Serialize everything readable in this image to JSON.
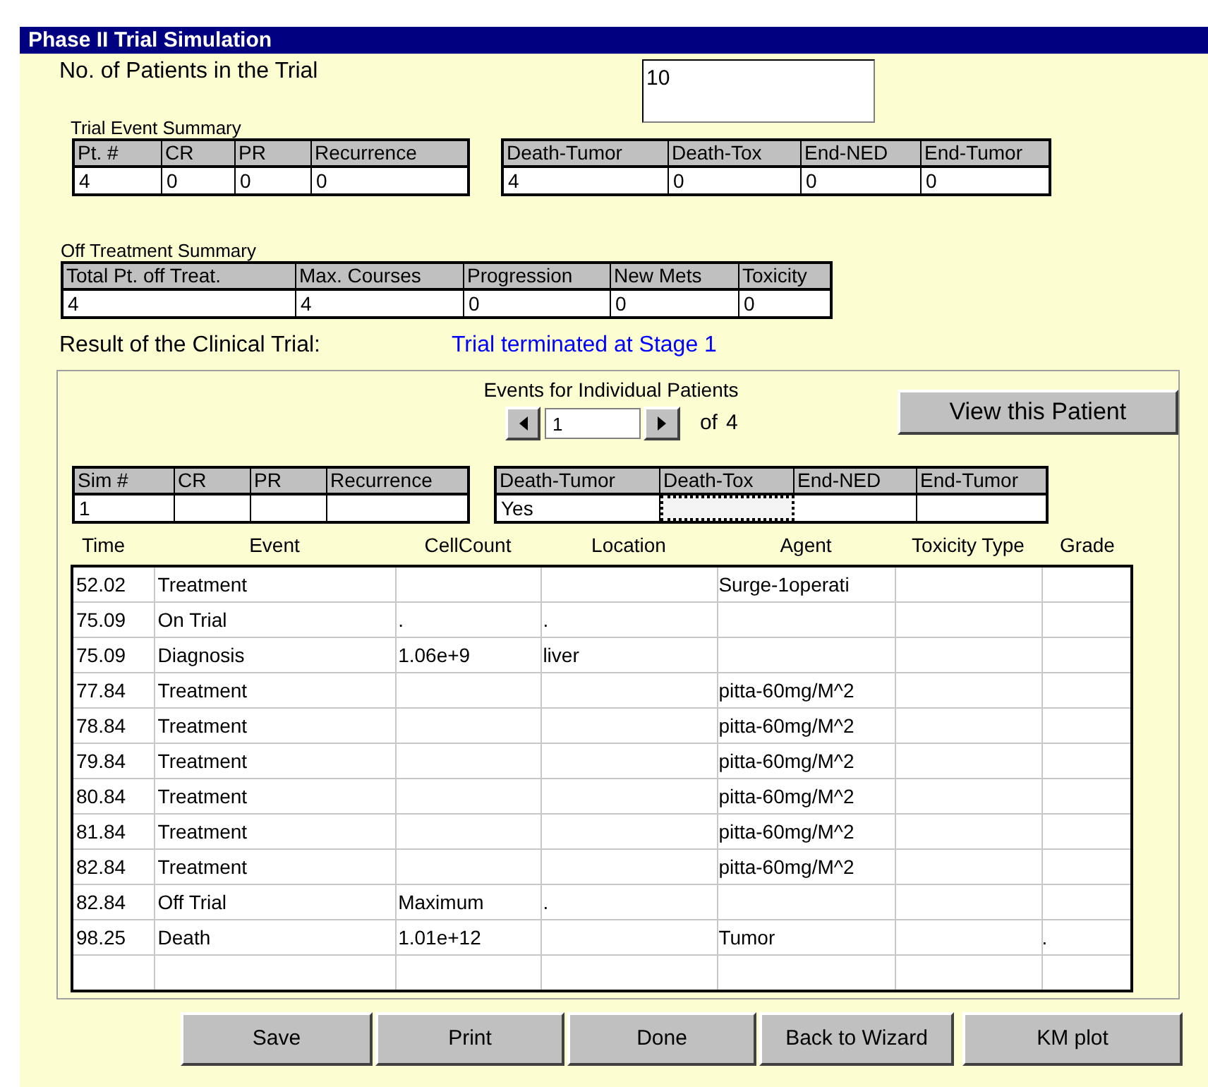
{
  "window": {
    "title": "Phase II Trial Simulation"
  },
  "patients_field": {
    "label": "No. of Patients in the Trial",
    "value": "10"
  },
  "trial_event_summary": {
    "title": "Trial Event Summary",
    "table_1": {
      "columns": [
        "Pt. #",
        "CR",
        "PR",
        "Recurrence"
      ],
      "row": [
        "4",
        "0",
        "0",
        "0"
      ]
    },
    "table_2": {
      "columns": [
        "Death-Tumor",
        "Death-Tox",
        "End-NED",
        "End-Tumor"
      ],
      "row": [
        "4",
        "0",
        "0",
        "0"
      ]
    }
  },
  "off_treatment_summary": {
    "title": "Off Treatment Summary",
    "columns": [
      "Total Pt. off Treat.",
      "Max. Courses",
      "Progression",
      "New Mets",
      "Toxicity"
    ],
    "row": [
      "4",
      "4",
      "0",
      "0",
      "0"
    ]
  },
  "result": {
    "label": "Result of the Clinical Trial:",
    "value": "Trial terminated at Stage 1"
  },
  "individual_events": {
    "title": "Events for Individual Patients",
    "patient_value": "1",
    "of_label": "of",
    "total": "4",
    "view_button": "View this Patient",
    "sim_table_1": {
      "columns": [
        "Sim #",
        "CR",
        "PR",
        "Recurrence"
      ],
      "row": [
        {
          "text": "1",
          "focused": false
        },
        {
          "focused": false
        },
        {
          "focused": false
        },
        {
          "focused": false
        }
      ]
    },
    "sim_table_2": {
      "columns": [
        "Death-Tumor",
        "Death-Tox",
        "End-NED",
        "End-Tumor"
      ],
      "row": [
        {
          "text": "Yes",
          "focused": false
        },
        {
          "focused": true
        },
        {
          "focused": false
        },
        {
          "focused": false
        }
      ]
    },
    "events_table": {
      "columns": [
        "Time",
        "Event",
        "CellCount",
        "Location",
        "Agent",
        "Toxicity Type",
        "Grade"
      ],
      "rows": [
        [
          "52.02",
          "Treatment",
          null,
          null,
          "Surge-1operati",
          null,
          null
        ],
        [
          "75.09",
          "On Trial",
          ".",
          ".",
          null,
          null,
          null
        ],
        [
          "75.09",
          "Diagnosis",
          "1.06e+9",
          "liver",
          null,
          null,
          null
        ],
        [
          "77.84",
          "Treatment",
          null,
          null,
          "pitta-60mg/M^2",
          null,
          null
        ],
        [
          "78.84",
          "Treatment",
          null,
          null,
          "pitta-60mg/M^2",
          null,
          null
        ],
        [
          "79.84",
          "Treatment",
          null,
          null,
          "pitta-60mg/M^2",
          null,
          null
        ],
        [
          "80.84",
          "Treatment",
          null,
          null,
          "pitta-60mg/M^2",
          null,
          null
        ],
        [
          "81.84",
          "Treatment",
          null,
          null,
          "pitta-60mg/M^2",
          null,
          null
        ],
        [
          "82.84",
          "Treatment",
          null,
          null,
          "pitta-60mg/M^2",
          null,
          null
        ],
        [
          "82.84",
          "Off Trial",
          "Maximum",
          ".",
          null,
          null,
          null
        ],
        [
          "98.25",
          "Death",
          "1.01e+12",
          null,
          "Tumor",
          null,
          "."
        ],
        [
          null,
          null,
          null,
          null,
          null,
          null,
          null
        ]
      ]
    }
  },
  "buttons": [
    "Save",
    "Print",
    "Done",
    "Back to Wizard",
    "KM plot"
  ]
}
